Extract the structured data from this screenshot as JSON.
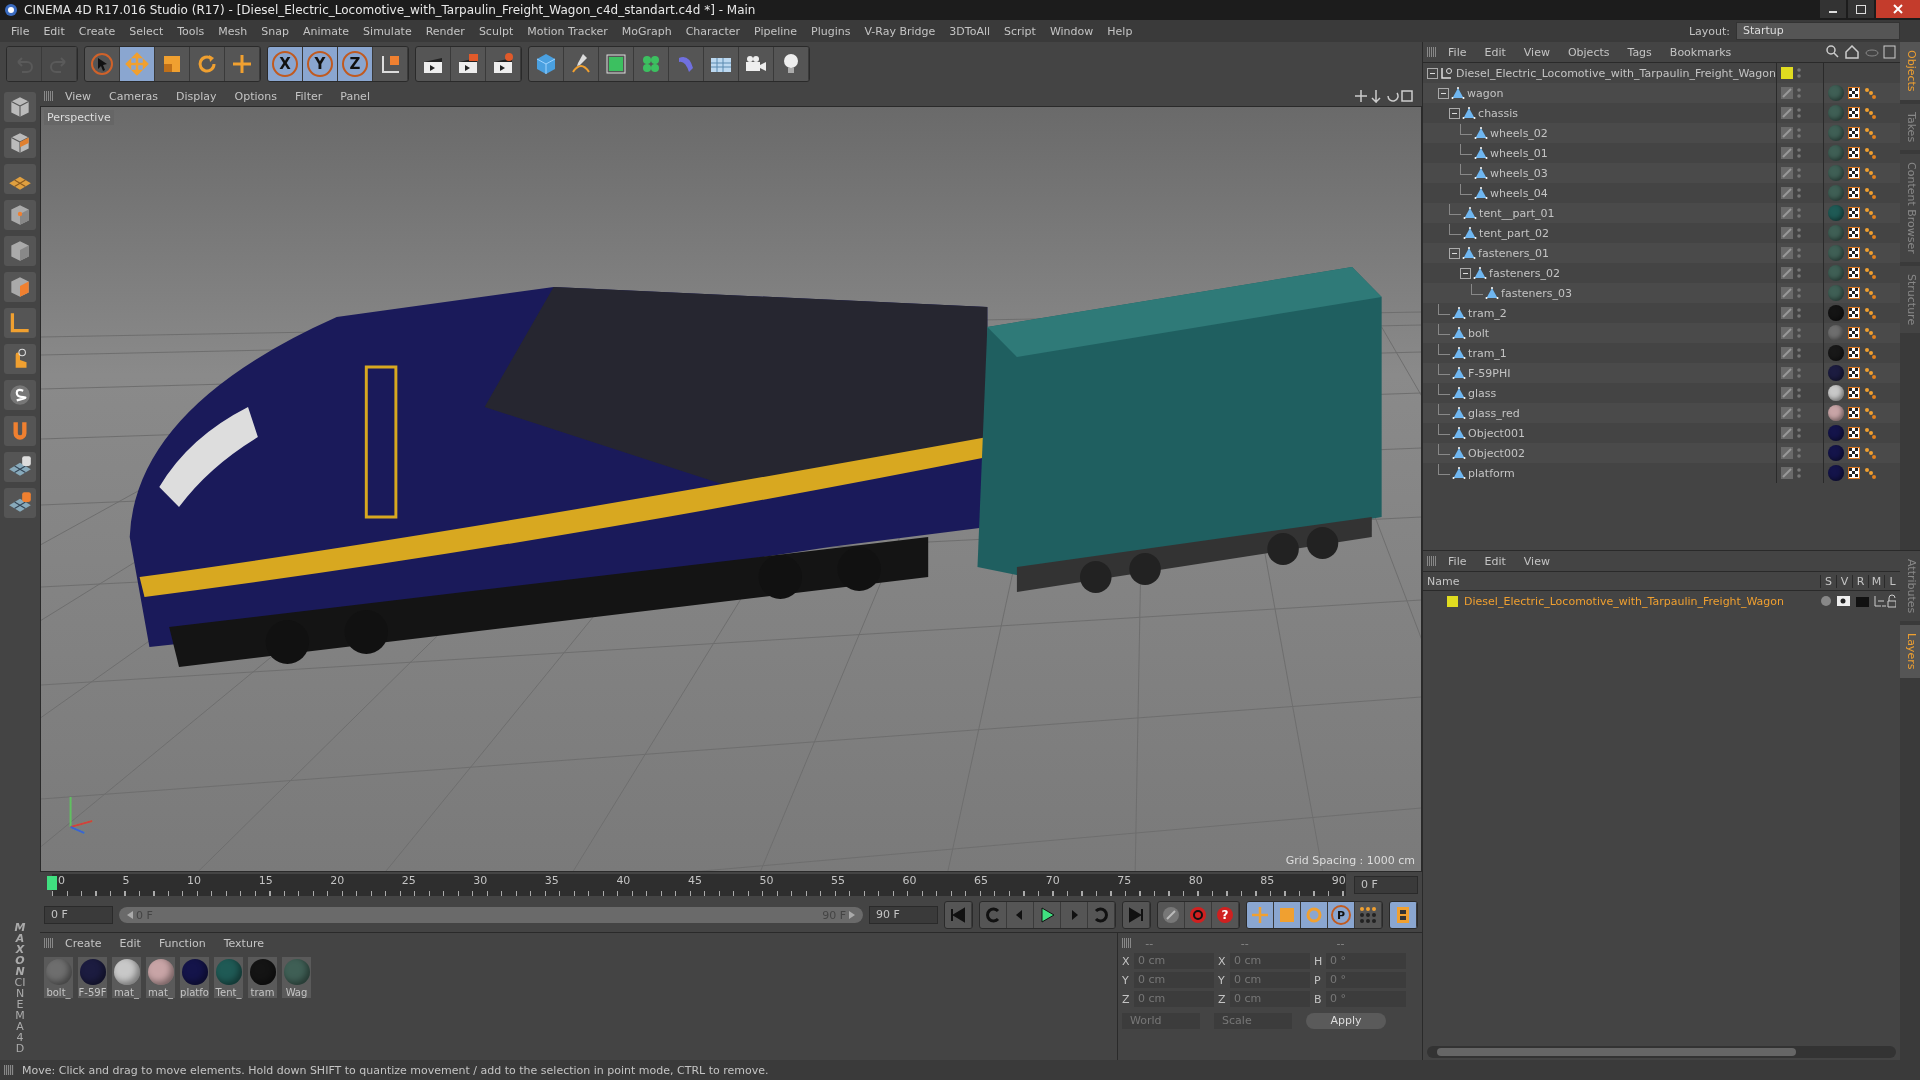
{
  "window": {
    "title": "CINEMA 4D R17.016 Studio (R17) - [Diesel_Electric_Locomotive_with_Tarpaulin_Freight_Wagon_c4d_standart.c4d *] - Main"
  },
  "menu_bar": [
    "File",
    "Edit",
    "Create",
    "Select",
    "Tools",
    "Mesh",
    "Snap",
    "Animate",
    "Simulate",
    "Render",
    "Sculpt",
    "Motion Tracker",
    "MoGraph",
    "Character",
    "Pipeline",
    "Plugins",
    "V-Ray Bridge",
    "3DToAll",
    "Script",
    "Window",
    "Help"
  ],
  "layout": {
    "label": "Layout:",
    "value": "Startup"
  },
  "toolbar": {
    "history": [
      {
        "disabled": true
      },
      {
        "disabled": true
      }
    ],
    "tools": [
      {
        "active": false
      },
      {
        "active": true
      },
      {
        "active": false
      },
      {
        "active": false
      },
      {
        "active": false
      }
    ],
    "axes": [
      {
        "label": "X",
        "active": true
      },
      {
        "label": "Y",
        "active": true
      },
      {
        "label": "Z",
        "active": true
      }
    ]
  },
  "viewport": {
    "menu": [
      "View",
      "Cameras",
      "Display",
      "Options",
      "Filter",
      "Panel"
    ],
    "camera": "Perspective",
    "grid_spacing": "Grid Spacing : 1000 cm"
  },
  "timeline": {
    "ticks": [
      "0",
      "5",
      "10",
      "15",
      "20",
      "25",
      "30",
      "35",
      "40",
      "45",
      "50",
      "55",
      "60",
      "65",
      "70",
      "75",
      "80",
      "85",
      "90"
    ],
    "playhead": {
      "level": 0
    },
    "current_frame": "0 F",
    "start": "0 F",
    "range": {
      "start": "0 F",
      "end": "90 F",
      "level": 1
    },
    "end": "90 F"
  },
  "transport": {
    "help": "?",
    "param": "P"
  },
  "material_manager": {
    "menu": [
      "Create",
      "Edit",
      "Function",
      "Texture"
    ],
    "materials": [
      {
        "label": "bolt_",
        "color": "#6e6e6e"
      },
      {
        "label": "F-59F",
        "color": "#1c1c40"
      },
      {
        "label": "mat_",
        "color": "#c8c8c8"
      },
      {
        "label": "mat_",
        "color": "#c8a4a6"
      },
      {
        "label": "platfo",
        "color": "#14144a"
      },
      {
        "label": "Tent_",
        "color": "#1f5a55"
      },
      {
        "label": "tram",
        "color": "#141414"
      },
      {
        "label": "Wag",
        "color": "#3f5f55"
      }
    ]
  },
  "coordinates": {
    "columns": [
      {
        "header": "--",
        "fields": [
          {
            "label": "X",
            "value": "0 cm",
            "disabled": true
          },
          {
            "label": "Y",
            "value": "0 cm",
            "disabled": true
          },
          {
            "label": "Z",
            "value": "0 cm",
            "disabled": true
          }
        ]
      },
      {
        "header": "--",
        "fields": [
          {
            "label": "X",
            "value": "0 cm",
            "disabled": true
          },
          {
            "label": "Y",
            "value": "0 cm",
            "disabled": true
          },
          {
            "label": "Z",
            "value": "0 cm",
            "disabled": true
          }
        ]
      },
      {
        "header": "--",
        "fields": [
          {
            "label": "H",
            "value": "0 °",
            "disabled": true
          },
          {
            "label": "P",
            "value": "0 °",
            "disabled": true
          },
          {
            "label": "B",
            "value": "0 °",
            "disabled": true
          }
        ]
      }
    ],
    "mode": "World",
    "scale": "Scale",
    "apply": "Apply"
  },
  "objects": {
    "menu": [
      "File",
      "Edit",
      "View",
      "Objects",
      "Tags",
      "Bookmarks"
    ],
    "root": {
      "name": "Diesel_Electric_Locomotive_with_Tarpaulin_Freight_Wagon",
      "color": "#e0dc20",
      "expanded": true,
      "children": [
        {
          "name": "wagon",
          "color": "#3f5f55",
          "expanded": true,
          "children": [
            {
              "name": "chassis",
              "color": "#3f5f55",
              "expanded": true,
              "children": [
                {
                  "name": "wheels_02",
                  "color": "#3f5f55"
                },
                {
                  "name": "wheels_01",
                  "color": "#3f5f55"
                },
                {
                  "name": "wheels_03",
                  "color": "#3f5f55"
                },
                {
                  "name": "wheels_04",
                  "color": "#3f5f55"
                }
              ]
            },
            {
              "name": "tent__part_01",
              "color": "#1f5a55"
            },
            {
              "name": "tent_part_02",
              "color": "#3f5f55"
            },
            {
              "name": "fasteners_01",
              "color": "#3f5f55",
              "expanded": true,
              "children": [
                {
                  "name": "fasteners_02",
                  "color": "#3f5f55",
                  "expanded": true,
                  "children": [
                    {
                      "name": "fasteners_03",
                      "color": "#3f5f55"
                    }
                  ]
                }
              ]
            }
          ]
        },
        {
          "name": "tram_2",
          "color": "#141414"
        },
        {
          "name": "bolt",
          "color": "#6e6e6e"
        },
        {
          "name": "tram_1",
          "color": "#181818"
        },
        {
          "name": "F-59PHI",
          "color": "#1c1c40"
        },
        {
          "name": "glass",
          "color": "#c8c8c8"
        },
        {
          "name": "glass_red",
          "color": "#c8a4a6"
        },
        {
          "name": "Object001",
          "color": "#14144a"
        },
        {
          "name": "Object002",
          "color": "#14144a"
        },
        {
          "name": "platform",
          "color": "#14144a"
        }
      ]
    }
  },
  "side_tabs_top": [
    {
      "label": "Objects",
      "selected": true
    },
    {
      "label": "Takes",
      "selected": false
    },
    {
      "label": "Content Browser",
      "selected": false
    },
    {
      "label": "Structure",
      "selected": false
    }
  ],
  "layers": {
    "menu": [
      "File",
      "Edit",
      "View"
    ],
    "columns": [
      "Name",
      "S",
      "V",
      "R",
      "M",
      "L"
    ],
    "rows": [
      {
        "name": "Diesel_Electric_Locomotive_with_Tarpaulin_Freight_Wagon",
        "color": "#e0dc20"
      }
    ]
  },
  "side_tabs_bottom": [
    {
      "label": "Attributes",
      "selected": false
    },
    {
      "label": "Layers",
      "selected": true
    }
  ],
  "brand": [
    "MAXON",
    "CINEMA 4D"
  ],
  "status_bar": "Move: Click and drag to move elements. Hold down SHIFT to quantize movement / add to the selection in point mode, CTRL to remove."
}
